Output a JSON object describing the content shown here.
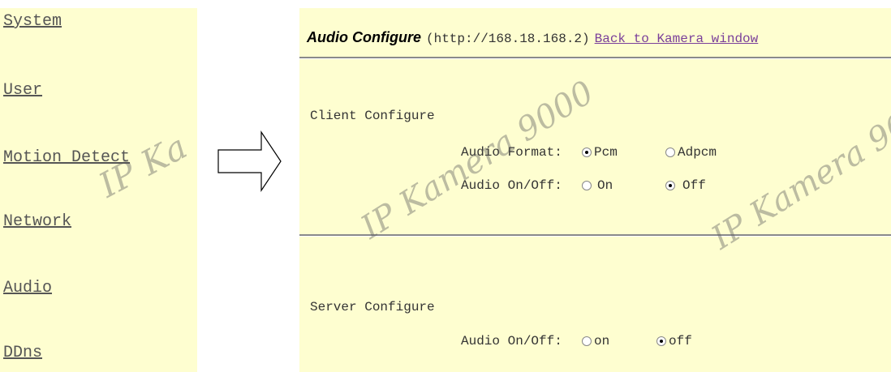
{
  "sidebar": {
    "items": [
      "System",
      "User",
      "Motion Detect",
      "Network",
      "Audio",
      "DDns"
    ],
    "watermark": "IP Ka"
  },
  "panel": {
    "title": "Audio Configure",
    "url": "(http://168.18.168.2)",
    "back_link": "Back to Kamera window",
    "watermark": "IP Kamera 9000",
    "client": {
      "label": "Client Configure",
      "format_label": "Audio Format:",
      "format_options": [
        "Pcm",
        "Adpcm"
      ],
      "format_selected": "Pcm",
      "onoff_label": "Audio On/Off:",
      "onoff_options": [
        "On",
        "Off"
      ],
      "onoff_selected": "Off"
    },
    "server": {
      "label": "Server Configure",
      "onoff_label": "Audio On/Off:",
      "onoff_options": [
        "on",
        "off"
      ],
      "onoff_selected": "off"
    }
  },
  "colors": {
    "background": "#fefed0",
    "link": "#555555",
    "visited_link": "#7a3f9a"
  }
}
